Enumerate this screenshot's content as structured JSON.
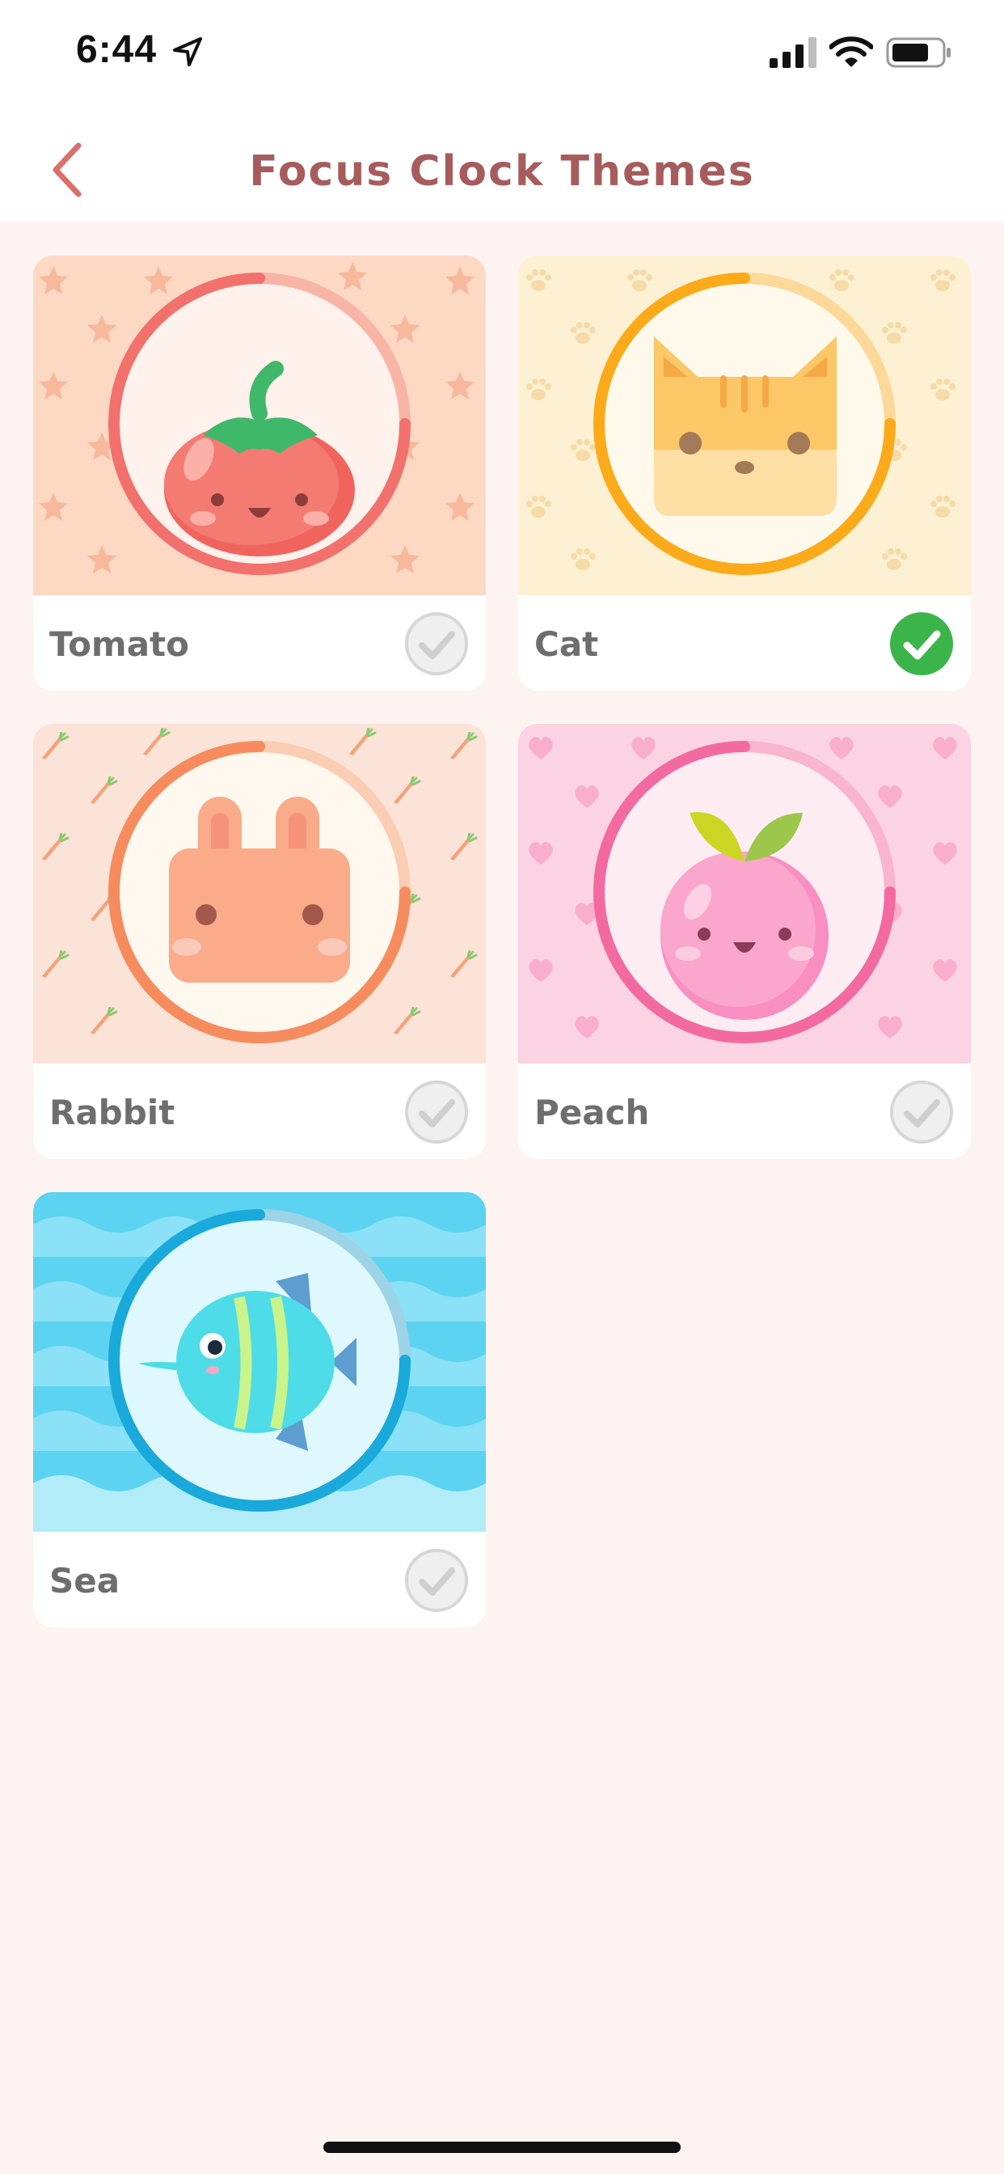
{
  "status_bar": {
    "time": "6:44"
  },
  "header": {
    "title": "Focus Clock Themes"
  },
  "themes": [
    {
      "name": "Tomato",
      "selected": false
    },
    {
      "name": "Cat",
      "selected": true
    },
    {
      "name": "Rabbit",
      "selected": false
    },
    {
      "name": "Peach",
      "selected": false
    },
    {
      "name": "Sea",
      "selected": false
    }
  ],
  "colors": {
    "title": "#A65C5C",
    "back_arrow": "#D9706A",
    "background": "#FDF3F0",
    "selected_check": "#3BB54A",
    "unselected_check": "#E3E3E3"
  }
}
